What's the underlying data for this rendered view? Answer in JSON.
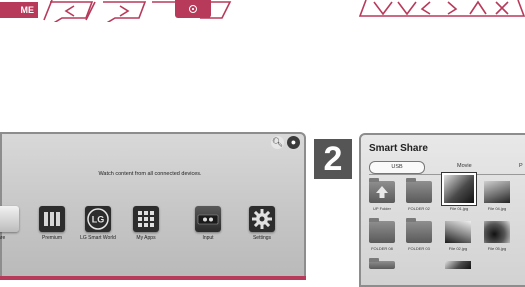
{
  "remote_strip": {
    "home_label": "ME"
  },
  "tv_home": {
    "message": "Watch content from all connected devices.",
    "apps": [
      {
        "label": "are",
        "icon": "smart-share-icon"
      },
      {
        "label": "Premium",
        "icon": "premium-icon"
      },
      {
        "label": "LG Smart World",
        "icon": "lg-logo-icon",
        "logo": "LG"
      },
      {
        "label": "My Apps",
        "icon": "my-apps-icon"
      },
      {
        "label": "Input",
        "icon": "input-icon"
      },
      {
        "label": "Settings",
        "icon": "settings-icon"
      }
    ]
  },
  "step_number": "2",
  "smart_share": {
    "title": "Smart Share",
    "tabs": [
      "USB",
      "Movie",
      "P"
    ],
    "items": [
      {
        "label": "UP Folder",
        "kind": "up-folder"
      },
      {
        "label": "FOLDER 02",
        "kind": "folder"
      },
      {
        "label": "File 01.jpg",
        "kind": "photo",
        "selected": true
      },
      {
        "label": "File 04.jpg",
        "kind": "photo"
      },
      {
        "label": "FOLDER 08",
        "kind": "folder"
      },
      {
        "label": "FOLDER 03",
        "kind": "folder"
      },
      {
        "label": "File 02.jpg",
        "kind": "photo"
      },
      {
        "label": "File 05.jpg",
        "kind": "photo"
      }
    ]
  },
  "colors": {
    "accent": "#b83a5a",
    "panel_bg": "#d0d0d0",
    "dark_icon": "#2d2d2d"
  }
}
